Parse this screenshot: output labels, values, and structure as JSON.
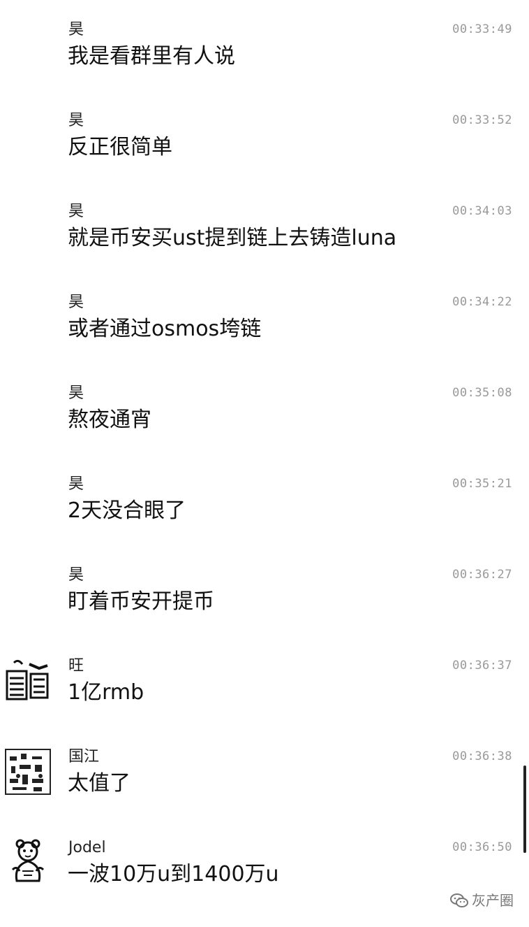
{
  "messages": [
    {
      "sender": "昊",
      "time": "00:33:49",
      "text": "我是看群里有人说"
    },
    {
      "sender": "昊",
      "time": "00:33:52",
      "text": "反正很简单"
    },
    {
      "sender": "昊",
      "time": "00:34:03",
      "text": "就是币安买ust提到链上去铸造luna"
    },
    {
      "sender": "昊",
      "time": "00:34:22",
      "text": "或者通过osmos垮链"
    },
    {
      "sender": "昊",
      "time": "00:35:08",
      "text": "熬夜通宵"
    },
    {
      "sender": "昊",
      "time": "00:35:21",
      "text": "2天没合眼了"
    },
    {
      "sender": "昊",
      "time": "00:36:27",
      "text": "盯着币安开提币"
    },
    {
      "sender": "旺",
      "time": "00:36:37",
      "text": "1亿rmb",
      "avatar": "sketch-avatar-icon"
    },
    {
      "sender": "国江",
      "time": "00:36:38",
      "text": "太值了",
      "avatar": "pattern-avatar-icon"
    },
    {
      "sender": "Jodel",
      "time": "00:36:50",
      "text": "一波10万u到1400万u",
      "avatar": "bear-avatar-icon"
    }
  ],
  "watermark": {
    "text": "灰产圈",
    "icon": "wechat-icon"
  },
  "colors": {
    "background": "#ffffff",
    "text": "#111111",
    "time": "#999999"
  }
}
